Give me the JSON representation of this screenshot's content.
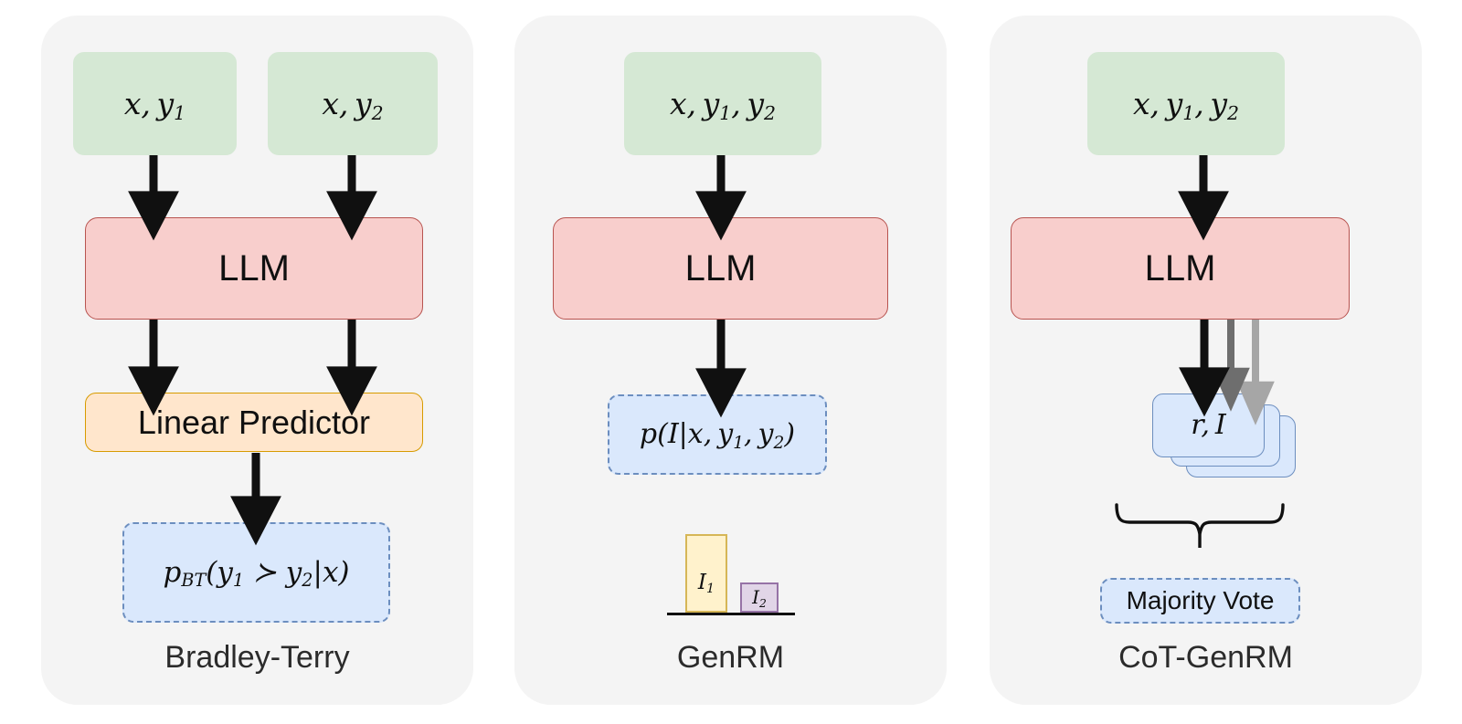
{
  "figure": {
    "background": "#ffffff",
    "panel_background": "#f4f4f4"
  },
  "colors": {
    "input_green_fill": "#d5e8d4",
    "llm_red_fill": "#f8cecc",
    "llm_red_border": "#b85450",
    "linear_orange_fill": "#ffe6cc",
    "linear_orange_border": "#d79b00",
    "output_blue_fill": "#dae8fc",
    "output_blue_border": "#6c8ebf",
    "bar1_fill": "#fff2cc",
    "bar1_border": "#d6b656",
    "bar2_fill": "#e1d5e7",
    "bar2_border": "#9673a6",
    "arrow_black": "#101010",
    "arrow_gray_dark": "#6e6e6e",
    "arrow_gray_light": "#a6a6a6",
    "label_text": "#2b2b2b"
  },
  "panels": [
    {
      "id": "bradley-terry",
      "label": "Bradley-Terry",
      "inputs": [
        {
          "id": "input-x-y1",
          "text_parts": {
            "base": "x, y",
            "sub": "1"
          }
        },
        {
          "id": "input-x-y2",
          "text_parts": {
            "base": "x, y",
            "sub": "2"
          }
        }
      ],
      "llm_label": "LLM",
      "predictor_label": "Linear Predictor",
      "output": {
        "id": "output-p-bt",
        "p": "p",
        "p_sub": "BT",
        "open": "(",
        "y1": "y",
        "y1_sub": "1",
        "succ": "≻",
        "y2": "y",
        "y2_sub": "2",
        "bar": "|",
        "x": "x",
        "close": ")"
      }
    },
    {
      "id": "genrm",
      "label": "GenRM",
      "inputs": [
        {
          "id": "input-x-y1-y2",
          "text_parts": {
            "base1": "x, y",
            "sub1": "1",
            "base2": ", y",
            "sub2": "2"
          }
        }
      ],
      "llm_label": "LLM",
      "output": {
        "id": "output-p-I",
        "p": "p",
        "open": "(",
        "I": "I",
        "bar": "|",
        "x": "x, y",
        "sub1": "1",
        "mid": ", y",
        "sub2": "2",
        "close": ")"
      }
    },
    {
      "id": "cot-genrm",
      "label": "CoT-GenRM",
      "inputs": [
        {
          "id": "input-x-y1-y2",
          "text_parts": {
            "base1": "x, y",
            "sub1": "1",
            "base2": ", y",
            "sub2": "2"
          }
        }
      ],
      "llm_label": "LLM",
      "sample_card_label": {
        "r": "r",
        "comma": ", ",
        "I": "I"
      },
      "sample_card_count": 3,
      "aggregate_label": "Majority Vote"
    }
  ],
  "chart_data": {
    "type": "bar",
    "title": "",
    "categories": [
      "I₁",
      "I₂"
    ],
    "labels": [
      "I",
      "I"
    ],
    "label_subs": [
      "1",
      "2"
    ],
    "values": [
      1.0,
      0.38
    ],
    "ylim": [
      0,
      1.15
    ],
    "xlabel": "",
    "ylabel": "",
    "grid": false,
    "legend": "none",
    "colors": [
      "#fff2cc",
      "#e1d5e7"
    ],
    "edge_colors": [
      "#d6b656",
      "#9673a6"
    ]
  }
}
